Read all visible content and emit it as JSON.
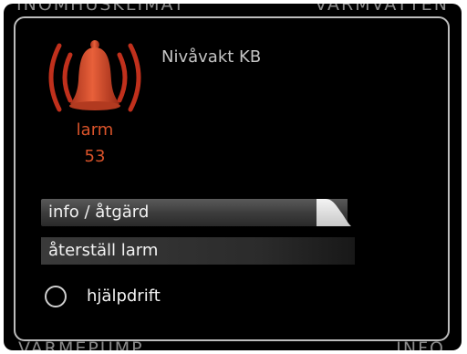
{
  "background_labels": {
    "top_left": "INOMHUSKLIMAT",
    "top_right": "VARMVATTEN",
    "bottom_left": "VÄRMEPUMP",
    "bottom_right": "INFO"
  },
  "alarm": {
    "title": "Nivåvakt KB",
    "label": "larm",
    "code": "53",
    "icon": "bell-alarm-icon"
  },
  "menu": {
    "info_label": "info / åtgärd",
    "reset_label": "återställ larm"
  },
  "option": {
    "label": "hjälpdrift",
    "selected": false
  },
  "colors": {
    "background": "#000000",
    "alarm_red": "#d9532a",
    "text": "#f2f2f2",
    "frame": "#bdbdbd"
  }
}
